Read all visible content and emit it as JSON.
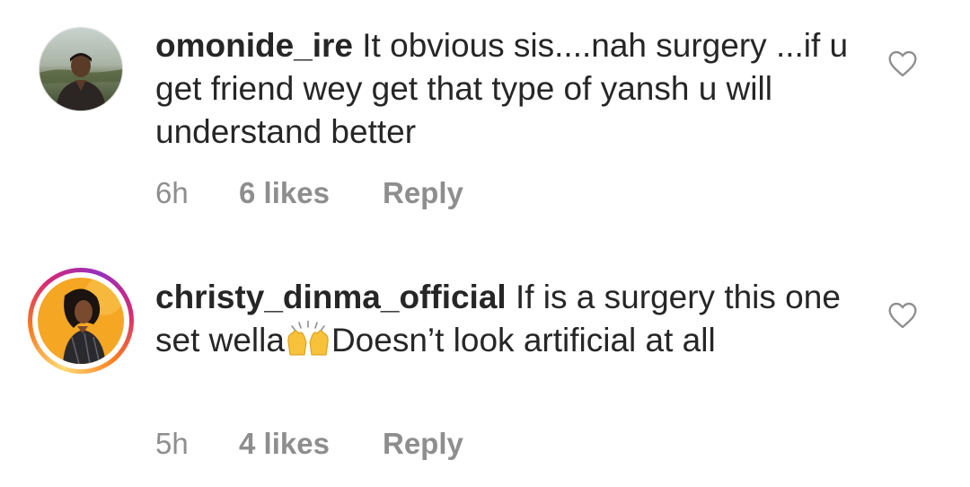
{
  "comments": [
    {
      "username": "omonide_ire",
      "text": "It obvious sis....nah surgery ...if u get friend wey get that type of yansh u will understand better",
      "time": "6h",
      "likes": "6 likes",
      "reply_label": "Reply",
      "has_story_ring": false,
      "icon": "heart-outline-icon"
    },
    {
      "username": "christy_dinma_official",
      "text_before_emoji": "If is a surgery this one set wella",
      "emoji": "raising-hands-emoji",
      "text_after_emoji": "Doesn’t look artificial at all",
      "time": "5h",
      "likes": "4 likes",
      "reply_label": "Reply",
      "has_story_ring": true,
      "icon": "heart-outline-icon"
    }
  ],
  "colors": {
    "text_primary": "#262626",
    "text_secondary": "#8e8e8e",
    "story_ring_gradient": [
      "#feda75",
      "#fa7e1e",
      "#d62976",
      "#962fbf"
    ],
    "avatar2_background": "#f5a623"
  }
}
